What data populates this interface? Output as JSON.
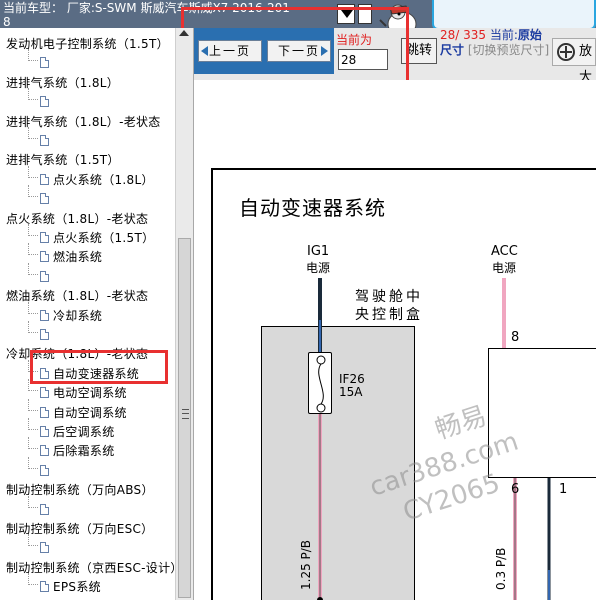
{
  "header": {
    "vehicle_label": "当前车型： 厂家:S-SWM 斯威汽车斯威X7 2016-2018"
  },
  "toolbar": {
    "prev_label": "上一页",
    "next_label": "下一页",
    "current_label": "当前为",
    "current_page": "28",
    "jump_label": "跳转",
    "page_fraction": "28/ 335",
    "current_prefix": "当前:",
    "size_label": "原始尺寸",
    "size_hint": "[切换预览尺寸]",
    "zoom_label": "放大"
  },
  "sidebar": {
    "items": [
      {
        "label": "发动机电子控制系统（1.5T）",
        "level": 0,
        "selected": false
      },
      {
        "label": "",
        "level": 1,
        "selected": false
      },
      {
        "label": "进排气系统（1.8L）",
        "level": 0,
        "selected": false
      },
      {
        "label": "",
        "level": 1,
        "selected": false
      },
      {
        "label": "进排气系统（1.8L）-老状态",
        "level": 0,
        "selected": false
      },
      {
        "label": "",
        "level": 1,
        "selected": false
      },
      {
        "label": "进排气系统（1.5T）",
        "level": 0,
        "selected": false
      },
      {
        "label": "点火系统（1.8L）",
        "level": 1,
        "selected": false
      },
      {
        "label": "",
        "level": 1,
        "selected": false
      },
      {
        "label": "点火系统（1.8L）-老状态",
        "level": 0,
        "selected": false
      },
      {
        "label": "点火系统（1.5T）",
        "level": 1,
        "selected": false
      },
      {
        "label": "燃油系统",
        "level": 1,
        "selected": false
      },
      {
        "label": "",
        "level": 1,
        "selected": false
      },
      {
        "label": "燃油系统（1.8L）-老状态",
        "level": 0,
        "selected": false
      },
      {
        "label": "冷却系统",
        "level": 1,
        "selected": false
      },
      {
        "label": "",
        "level": 1,
        "selected": false
      },
      {
        "label": "冷却系统（1.8L）-老状态",
        "level": 0,
        "selected": false
      },
      {
        "label": "自动变速器系统",
        "level": 1,
        "selected": true
      },
      {
        "label": "电动空调系统",
        "level": 1,
        "selected": false
      },
      {
        "label": "自动空调系统",
        "level": 1,
        "selected": false
      },
      {
        "label": "后空调系统",
        "level": 1,
        "selected": false
      },
      {
        "label": "后除霜系统",
        "level": 1,
        "selected": false
      },
      {
        "label": "",
        "level": 1,
        "selected": false
      },
      {
        "label": "制动控制系统（万向ABS）",
        "level": 0,
        "selected": false
      },
      {
        "label": "",
        "level": 1,
        "selected": false
      },
      {
        "label": "制动控制系统（万向ESC）",
        "level": 0,
        "selected": false
      },
      {
        "label": "",
        "level": 1,
        "selected": false
      },
      {
        "label": "制动控制系统（京西ESC-设计）",
        "level": 0,
        "selected": false
      },
      {
        "label": "EPS系统",
        "level": 1,
        "selected": false
      }
    ]
  },
  "diagram": {
    "title": "自动变速器系统",
    "ig1_name": "IG1",
    "ig1_sub": "电源",
    "acc_name": "ACC",
    "acc_sub": "电源",
    "cabin_box_label": "驾驶舱中央控制盒",
    "fuse_name": "IF26",
    "fuse_rating": "15A",
    "pin_8": "8",
    "pin_6": "6",
    "pin_1": "1",
    "wire_left": "1.25 P/B",
    "wire_right": "0.3 P/B",
    "watermark": [
      "畅易",
      "car388.com",
      "CY2065"
    ],
    "colors": {
      "wire_pink": "#f0a6c0",
      "wire_dark": "#1a2a3a",
      "wire_blue": "#3a7ad8"
    }
  },
  "colors": {
    "topbar_bg": "#5a6c84",
    "pager_bg": "#2a6fb0",
    "highlight_red": "#e83030",
    "accent_blue": "#2aa6e0"
  }
}
